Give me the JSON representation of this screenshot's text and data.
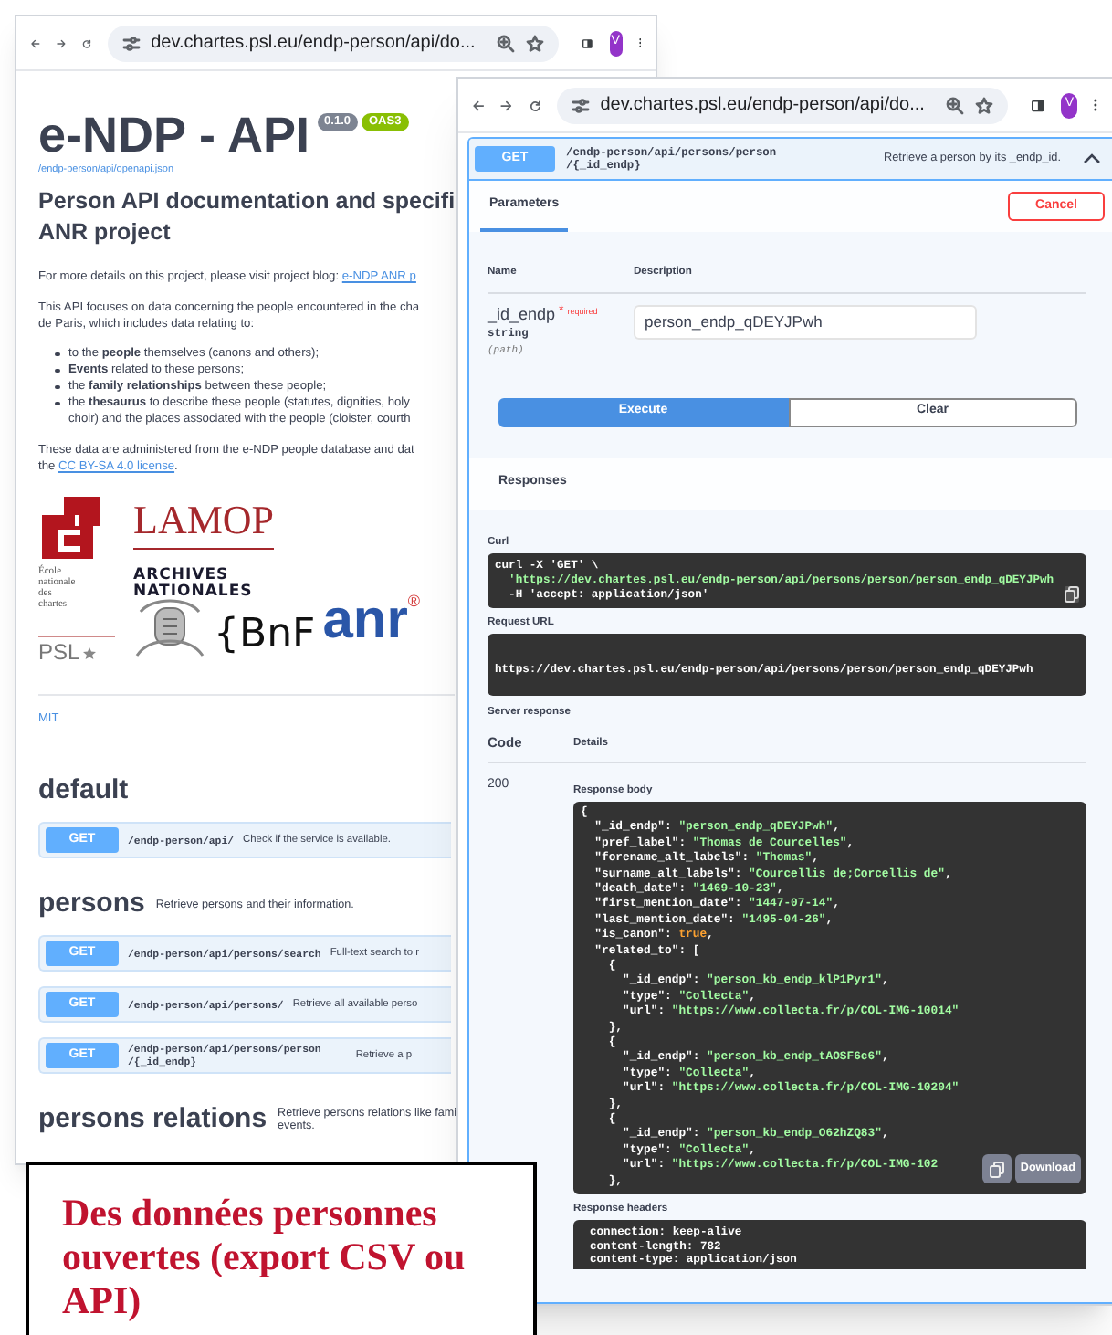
{
  "back_window": {
    "url": "dev.chartes.psl.eu/endp-person/api/do...",
    "avatar": "V",
    "title": "e-NDP - API",
    "version": "0.1.0",
    "spec_badge": "OAS3",
    "spec_link": "/endp-person/api/openapi.json",
    "heading_lines": [
      "Person API documentation and specifi",
      "ANR project"
    ],
    "intro": {
      "text": "For more details on this project, please visit project blog: ",
      "link": "e-NDP ANR p"
    },
    "scope_lines": [
      "This API focuses on data concerning the people encountered in the cha",
      "de Paris, which includes data relating to:"
    ],
    "bullets": [
      {
        "lines": [
          "to the **people** themselves (canons and others);"
        ]
      },
      {
        "lines": [
          "**Events** related to these persons;"
        ]
      },
      {
        "lines": [
          "the **family relationships** between these people;"
        ]
      },
      {
        "lines": [
          "the **thesaurus** to describe these people (statutes, dignities, holy",
          "choir) and the places associated with the people (cloister, courth"
        ]
      }
    ],
    "license": {
      "line": "These data are administered from the e-NDP people database and dat",
      "before": "the ",
      "link": "CC BY-SA 4.0 license",
      "after": "."
    },
    "logos": [
      {
        "kind": "enc",
        "lines": [
          "École",
          "nationale",
          "des",
          "chartes"
        ]
      },
      {
        "kind": "lamop",
        "text": "LAMOP"
      },
      {
        "kind": "archives",
        "lines": [
          "ARCHIVES",
          "NATIONALES"
        ]
      },
      {
        "kind": "psl",
        "text": "PSL"
      },
      {
        "kind": "bnf",
        "text": "{BnF"
      },
      {
        "kind": "anr",
        "text": "anr",
        "mark": "®"
      }
    ],
    "license_name": "MIT",
    "sections": [
      {
        "name": "default",
        "ops": [
          {
            "method": "GET",
            "path_lines": [
              "/endp-person/api/"
            ],
            "summary": "Check if the service is available."
          }
        ]
      },
      {
        "name": "persons",
        "description_lines": [
          "Retrieve persons and their information."
        ],
        "ops": [
          {
            "method": "GET",
            "path_lines": [
              "/endp-person/api/persons/search"
            ],
            "summary": "Full-text search to r"
          },
          {
            "method": "GET",
            "path_lines": [
              "/endp-person/api/persons/"
            ],
            "summary": "Retrieve all available perso"
          },
          {
            "method": "GET",
            "path_lines": [
              "/endp-person/api/persons/person",
              "/{_id_endp}"
            ],
            "summary": "Retrieve a p"
          }
        ]
      },
      {
        "name": "persons relations",
        "description_lines": [
          "Retrieve persons relations like fami",
          "events."
        ]
      }
    ]
  },
  "front_window": {
    "url": "dev.chartes.psl.eu/endp-person/api/do...",
    "avatar": "V",
    "operation": {
      "method": "GET",
      "path_lines": [
        "/endp-person/api/persons/person",
        "/{_id_endp}"
      ],
      "summary": "Retrieve a person by its _endp_id.",
      "expanded": true
    },
    "tabs": [
      {
        "label": "Parameters",
        "selected": true
      }
    ],
    "cancel_button": "Cancel",
    "param_columns": [
      "Name",
      "Description"
    ],
    "parameter": {
      "name": "_id_endp",
      "required_mark": "*",
      "required_label": "required",
      "type": "string",
      "location": "(path)",
      "value": "person_endp_qDEYJPwh"
    },
    "buttons": [
      {
        "label": "Execute",
        "kind": "primary"
      },
      {
        "label": "Clear",
        "kind": "secondary"
      }
    ],
    "responses_title": "Responses",
    "curl_label": "Curl",
    "curl_lines": [
      "curl -X 'GET' \\",
      "  'https://dev.chartes.psl.eu/endp-person/api/persons/person/person_endp_qDEYJPwh",
      "  -H 'accept: application/json'"
    ],
    "request_url_label": "Request URL",
    "request_url": "https://dev.chartes.psl.eu/endp-person/api/persons/person/person_endp_qDEYJPwh",
    "server_response_label": "Server response",
    "response_columns": [
      "Code",
      "Details"
    ],
    "code": "200",
    "response_body_label": "Response body",
    "response_body_lines": [
      "{",
      "  \"_id_endp\": \"person_endp_qDEYJPwh\",",
      "  \"pref_label\": \"Thomas de Courcelles\",",
      "  \"forename_alt_labels\": \"Thomas\",",
      "  \"surname_alt_labels\": \"Courcellis de;Corcellis de\",",
      "  \"death_date\": \"1469-10-23\",",
      "  \"first_mention_date\": \"1447-07-14\",",
      "  \"last_mention_date\": \"1495-04-26\",",
      "  \"is_canon\": true,",
      "  \"related_to\": [",
      "    {",
      "      \"_id_endp\": \"person_kb_endp_klP1Pyr1\",",
      "      \"type\": \"Collecta\",",
      "      \"url\": \"https://www.collecta.fr/p/COL-IMG-10014\"",
      "    },",
      "    {",
      "      \"_id_endp\": \"person_kb_endp_tAOSF6c6\",",
      "      \"type\": \"Collecta\",",
      "      \"url\": \"https://www.collecta.fr/p/COL-IMG-10204\"",
      "    },",
      "    {",
      "      \"_id_endp\": \"person_kb_endp_O62hZQ83\",",
      "      \"type\": \"Collecta\",",
      "      \"url\": \"https://www.collecta.fr/p/COL-IMG-102",
      "    },"
    ],
    "download_button": "Download",
    "response_headers_label": "Response headers",
    "response_headers_lines": [
      "connection: keep-alive",
      "content-length: 782",
      "content-type: application/json"
    ]
  },
  "caption": "Des données personnes ouvertes (export CSV ou API)"
}
